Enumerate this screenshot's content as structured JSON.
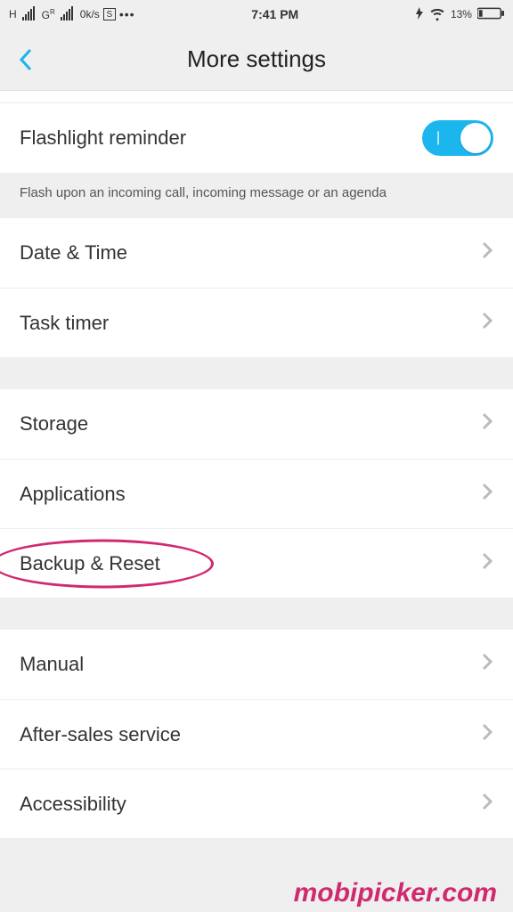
{
  "status": {
    "signal1_label": "H",
    "signal2_label": "G",
    "signal2_sup": "R",
    "speed": "0k/s",
    "s_box": "S",
    "dots": "•••",
    "time": "7:41 PM",
    "battery_pct": "13%"
  },
  "header": {
    "title": "More settings"
  },
  "flashlight": {
    "label": "Flashlight reminder",
    "description": "Flash upon an incoming call, incoming message or an agenda",
    "toggle_on_mark": "|",
    "enabled": true
  },
  "group1": {
    "date_time": "Date & Time",
    "task_timer": "Task timer"
  },
  "group2": {
    "storage": "Storage",
    "applications": "Applications",
    "backup_reset": "Backup & Reset"
  },
  "group3": {
    "manual": "Manual",
    "after_sales": "After-sales service",
    "accessibility": "Accessibility"
  },
  "watermark": "mobipicker.com"
}
